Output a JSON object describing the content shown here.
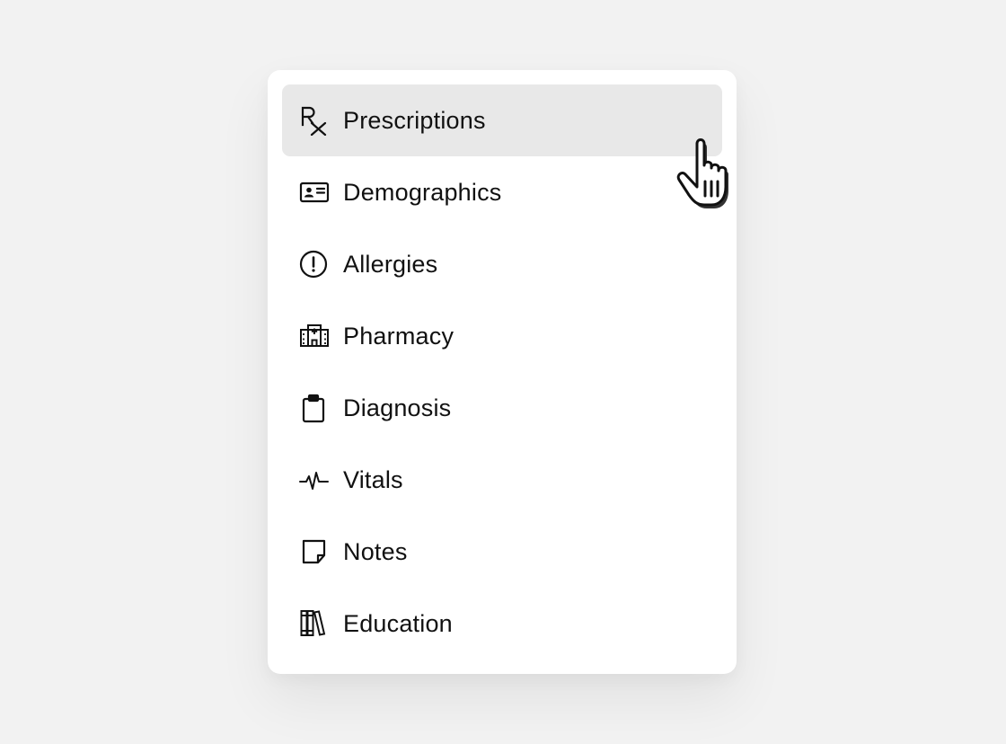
{
  "menu": {
    "items": [
      {
        "label": "Prescriptions",
        "icon": "rx-icon",
        "active": true
      },
      {
        "label": "Demographics",
        "icon": "id-card-icon",
        "active": false
      },
      {
        "label": "Allergies",
        "icon": "alert-circle-icon",
        "active": false
      },
      {
        "label": "Pharmacy",
        "icon": "hospital-building-icon",
        "active": false
      },
      {
        "label": "Diagnosis",
        "icon": "clipboard-icon",
        "active": false
      },
      {
        "label": "Vitals",
        "icon": "pulse-icon",
        "active": false
      },
      {
        "label": "Notes",
        "icon": "sticky-note-icon",
        "active": false
      },
      {
        "label": "Education",
        "icon": "books-icon",
        "active": false
      }
    ]
  },
  "colors": {
    "page_background": "#f2f2f2",
    "card_background": "#ffffff",
    "active_item_background": "#e8e8e8",
    "text": "#111111"
  },
  "cursor": {
    "icon": "hand-pointer-icon"
  }
}
